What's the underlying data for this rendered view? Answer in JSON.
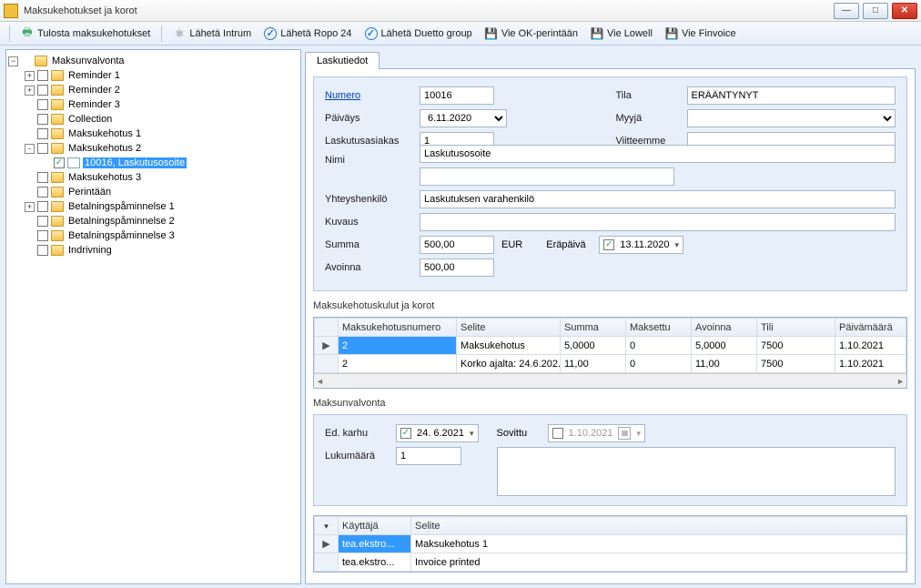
{
  "window": {
    "title": "Maksukehotukset ja korot"
  },
  "toolbar": {
    "print": "Tulosta maksukehotukset",
    "intrum": "Lähetä Intrum",
    "ropo": "Lähetä Ropo 24",
    "duetto": "Lähetä Duetto group",
    "ok": "Vie OK-perintään",
    "lowell": "Vie Lowell",
    "finvoice": "Vie Finvoice"
  },
  "tree": {
    "root": "Maksunvalvonta",
    "items": [
      {
        "label": "Reminder 1",
        "exp": "+"
      },
      {
        "label": "Reminder 2",
        "exp": "+"
      },
      {
        "label": "Reminder 3",
        "exp": ""
      },
      {
        "label": "Collection",
        "exp": ""
      },
      {
        "label": "Maksukehotus 1",
        "exp": ""
      },
      {
        "label": "Maksukehotus 2",
        "exp": "-",
        "children": [
          {
            "label": "10016, Laskutusosoite",
            "checked": true,
            "selected": true
          }
        ]
      },
      {
        "label": "Maksukehotus 3",
        "exp": ""
      },
      {
        "label": "Perintään",
        "exp": ""
      },
      {
        "label": "Betalningspåminnelse 1",
        "exp": "+"
      },
      {
        "label": "Betalningspåminnelse 2",
        "exp": ""
      },
      {
        "label": "Betalningspåminnelse 3",
        "exp": ""
      },
      {
        "label": "Indrivning",
        "exp": ""
      }
    ]
  },
  "tab": {
    "invoice": "Laskutiedot"
  },
  "form": {
    "numero_label": "Numero",
    "numero": "10016",
    "paivays_label": "Päiväys",
    "paivays": "6.11.2020",
    "laskutusasiakas_label": "Laskutusasiakas",
    "laskutusasiakas": "1",
    "nimi_label": "Nimi",
    "nimi": "Laskutusosoite",
    "tila_label": "Tila",
    "tila": "ERÄÄNTYNYT",
    "myyja_label": "Myyjä",
    "myyja": "",
    "viitteemme_label": "Viitteemme",
    "viitteemme": "",
    "yhteyshenkilo_label": "Yhteyshenkilö",
    "yhteyshenkilo": "Laskutuksen varahenkilö",
    "kuvaus_label": "Kuvaus",
    "kuvaus": "",
    "summa_label": "Summa",
    "summa": "500,00",
    "currency": "EUR",
    "erapaiva_label": "Eräpäivä",
    "erapaiva": "13.11.2020",
    "avoinna_label": "Avoinna",
    "avoinna": "500,00"
  },
  "costs": {
    "title": "Maksukehotuskulut ja korot",
    "headers": {
      "num": "Maksukehotusnumero",
      "selite": "Selite",
      "summa": "Summa",
      "maksettu": "Maksettu",
      "avoinna": "Avoinna",
      "tili": "Tili",
      "pvm": "Päivämäärä"
    },
    "rows": [
      {
        "num": "2",
        "selite": "Maksukehotus",
        "summa": "5,0000",
        "maksettu": "0",
        "avoinna": "5,0000",
        "tili": "7500",
        "pvm": "1.10.2021",
        "sel": true
      },
      {
        "num": "2",
        "selite": "Korko ajalta: 24.6.202...",
        "summa": "11,00",
        "maksettu": "0",
        "avoinna": "11,00",
        "tili": "7500",
        "pvm": "1.10.2021"
      }
    ]
  },
  "mv": {
    "title": "Maksunvalvonta",
    "edkarhu_label": "Ed. karhu",
    "edkarhu": "24.  6.2021",
    "sovittu_label": "Sovittu",
    "sovittu": "1.10.2021",
    "lukumaara_label": "Lukumäärä",
    "lukumaara": "1"
  },
  "log": {
    "headers": {
      "user": "Käyttäjä",
      "selite": "Selite"
    },
    "rows": [
      {
        "user": "tea.ekstro...",
        "selite": "Maksukehotus 1",
        "sel": true
      },
      {
        "user": "tea.ekstro...",
        "selite": "Invoice printed"
      }
    ]
  }
}
